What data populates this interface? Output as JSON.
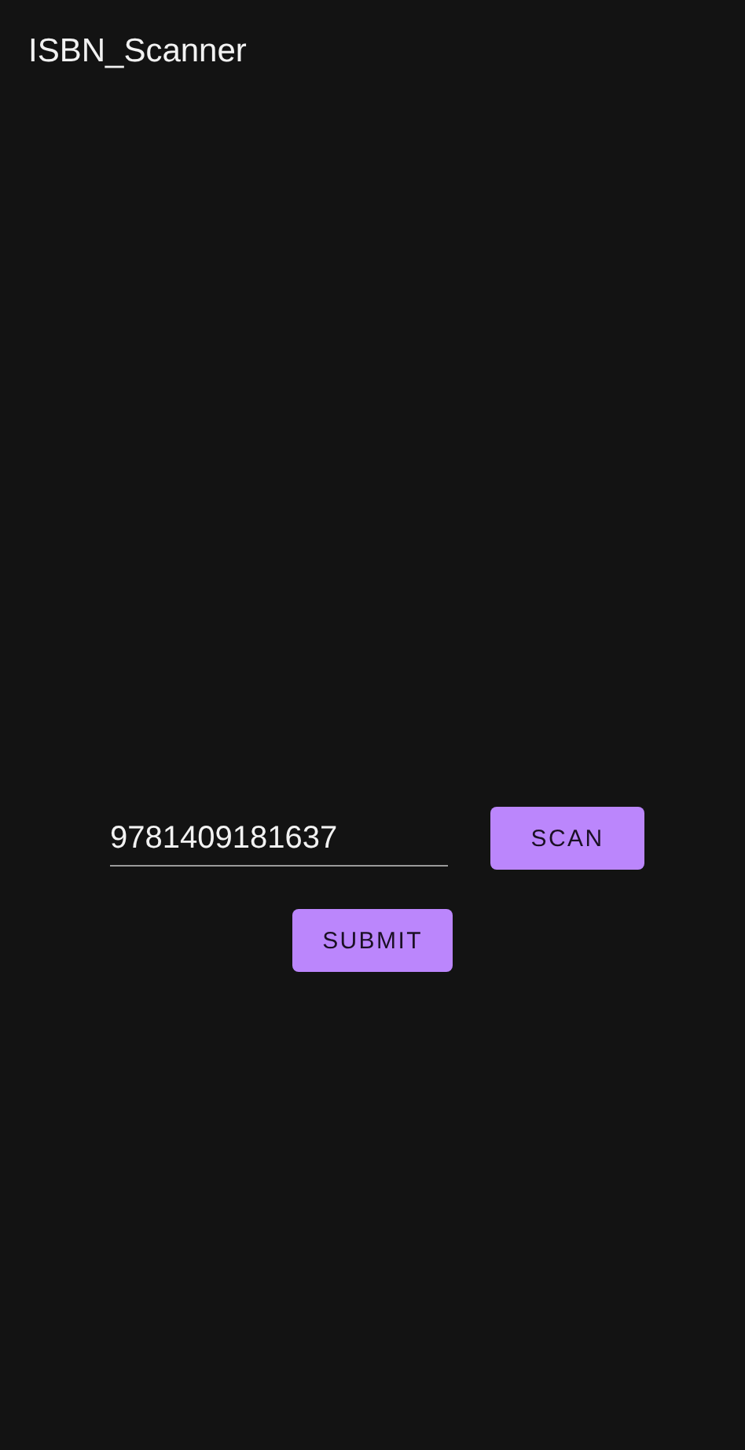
{
  "app_bar": {
    "title": "ISBN_Scanner"
  },
  "isbn_field": {
    "value": "9781409181637"
  },
  "buttons": [
    {
      "kind": "scan",
      "label": "SCAN"
    },
    {
      "kind": "submit",
      "label": "SUBMIT"
    }
  ]
}
